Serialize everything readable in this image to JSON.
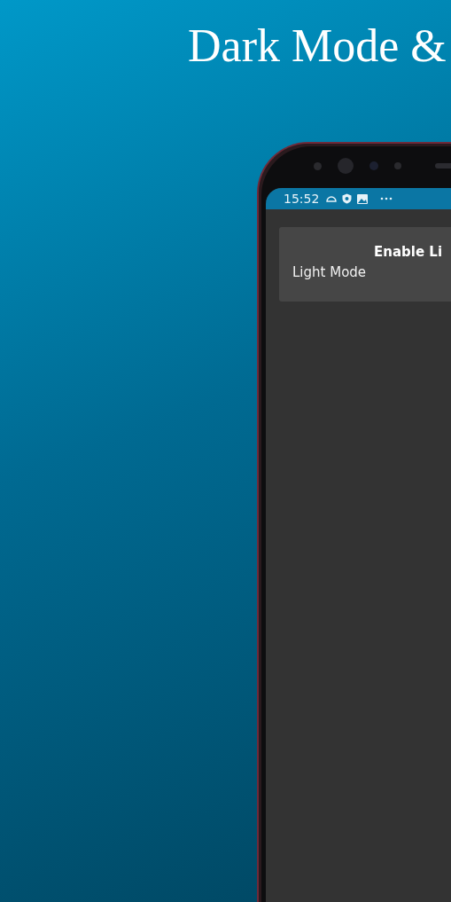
{
  "headline": "Dark Mode &",
  "status_bar": {
    "time": "15:52"
  },
  "setting_card": {
    "title": "Enable Li",
    "label": "Light Mode"
  }
}
